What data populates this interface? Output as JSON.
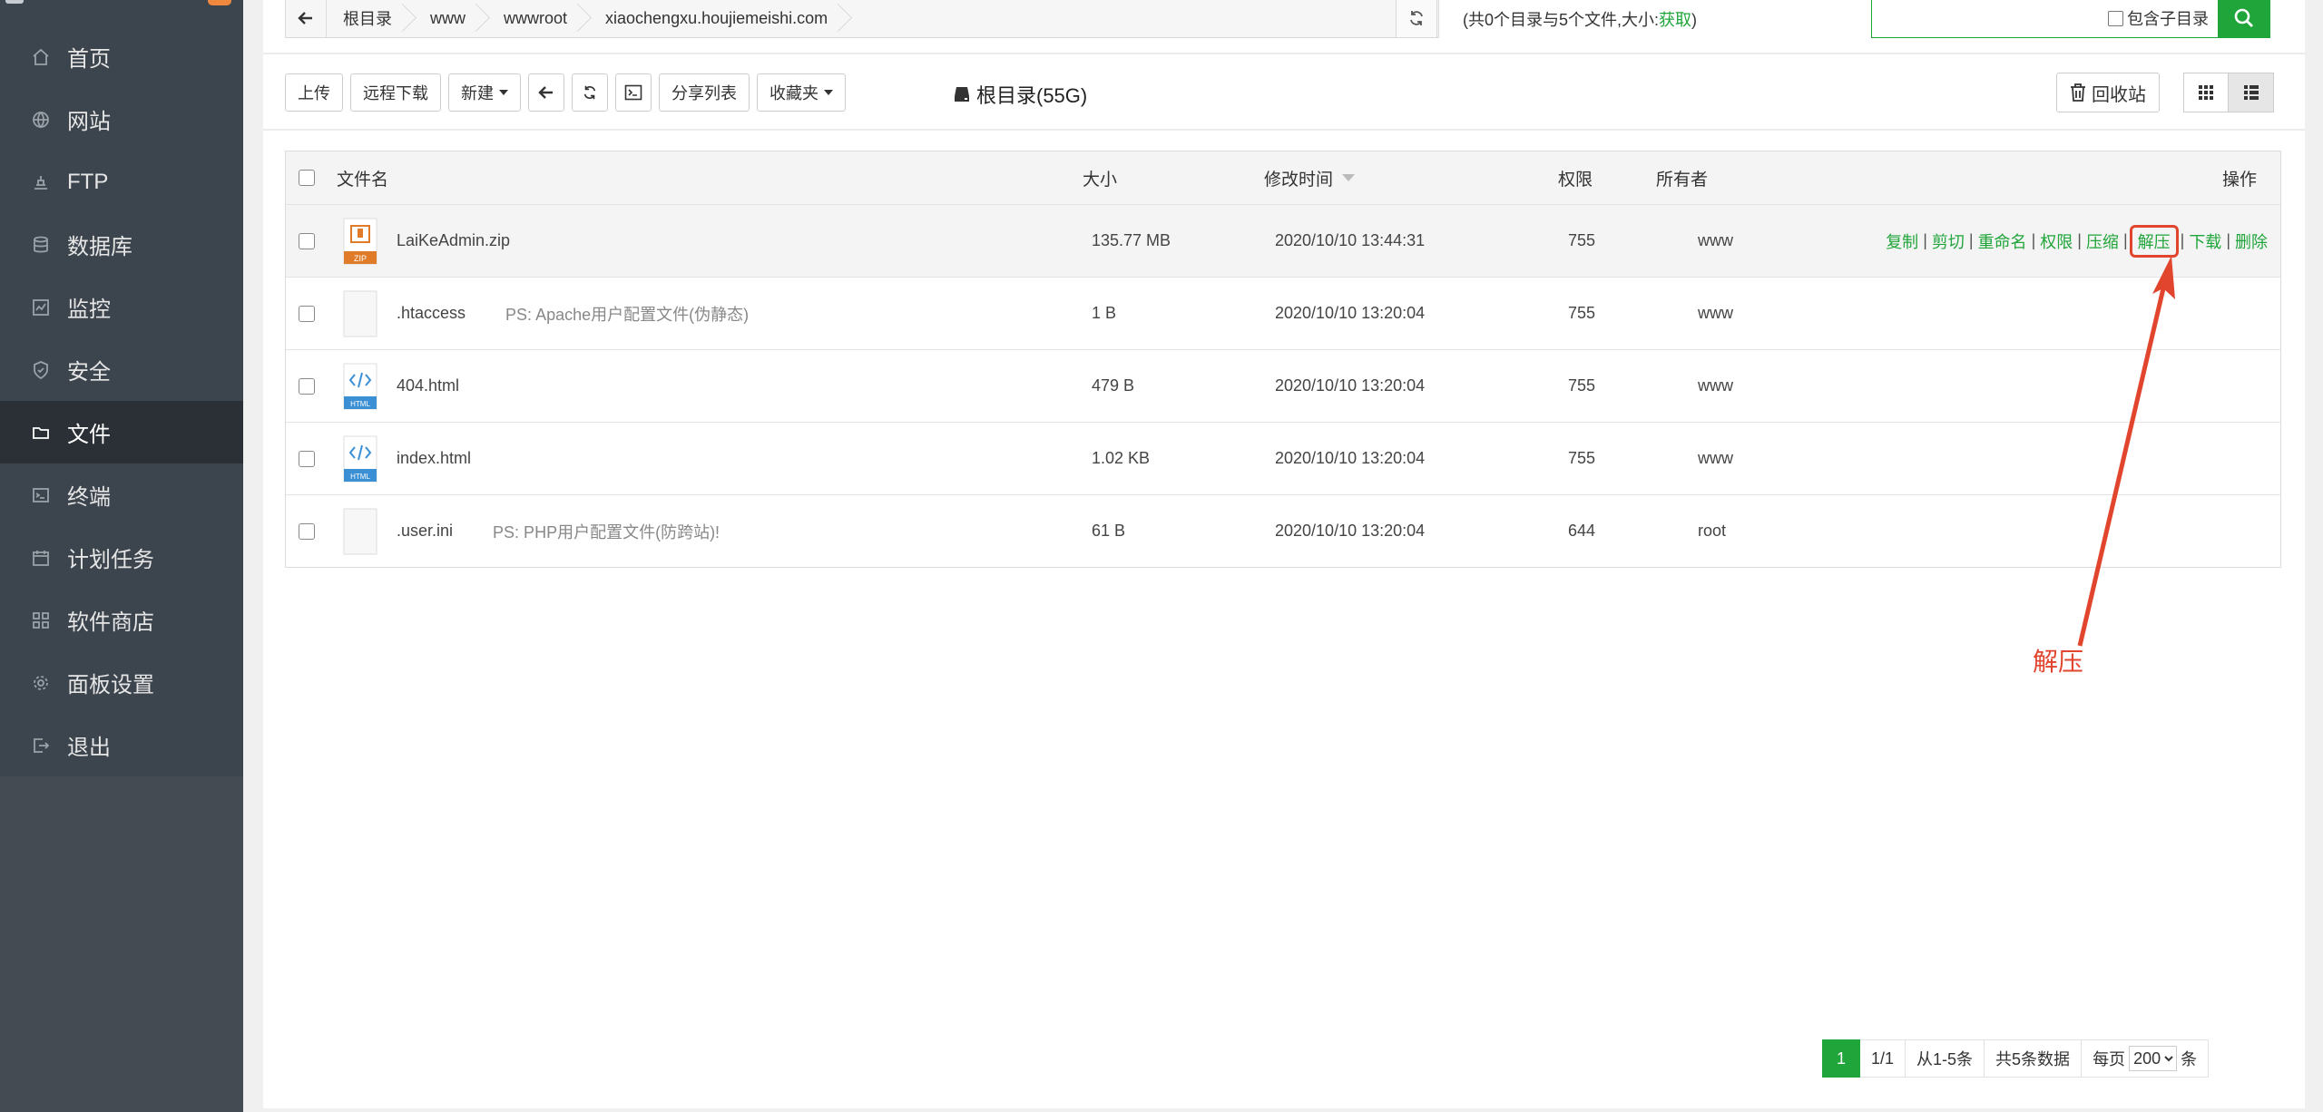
{
  "sidebar": {
    "items": [
      {
        "label": "首页",
        "icon": "home-icon"
      },
      {
        "label": "网站",
        "icon": "globe-icon"
      },
      {
        "label": "FTP",
        "icon": "ftp-icon"
      },
      {
        "label": "数据库",
        "icon": "database-icon"
      },
      {
        "label": "监控",
        "icon": "monitor-icon"
      },
      {
        "label": "安全",
        "icon": "shield-icon"
      },
      {
        "label": "文件",
        "icon": "folder-icon",
        "active": true
      },
      {
        "label": "终端",
        "icon": "terminal-icon"
      },
      {
        "label": "计划任务",
        "icon": "calendar-icon"
      },
      {
        "label": "软件商店",
        "icon": "grid-icon"
      },
      {
        "label": "面板设置",
        "icon": "gear-icon"
      },
      {
        "label": "退出",
        "icon": "logout-icon"
      }
    ]
  },
  "pathbar": {
    "crumbs": [
      "根目录",
      "www",
      "wwwroot",
      "xiaochengxu.houjiemeishi.com"
    ],
    "info_prefix": "(共0个目录与5个文件,大小:",
    "info_link": "获取",
    "info_suffix": ")"
  },
  "search": {
    "placeholder": "",
    "subdir_label": "包含子目录"
  },
  "toolbar": {
    "upload": "上传",
    "remote_download": "远程下载",
    "new": "新建",
    "share_list": "分享列表",
    "favorites": "收藏夹",
    "disk_label": "根目录(55G)",
    "recycle": "回收站"
  },
  "table": {
    "headers": {
      "name": "文件名",
      "size": "大小",
      "mtime": "修改时间",
      "perm": "权限",
      "owner": "所有者",
      "ops": "操作"
    },
    "rows": [
      {
        "name": "LaiKeAdmin.zip",
        "note": "",
        "size": "135.77 MB",
        "mtime": "2020/10/10 13:44:31",
        "perm": "755",
        "owner": "www",
        "type": "zip"
      },
      {
        "name": ".htaccess",
        "note": "PS: Apache用户配置文件(伪静态)",
        "size": "1 B",
        "mtime": "2020/10/10 13:20:04",
        "perm": "755",
        "owner": "www",
        "type": "file"
      },
      {
        "name": "404.html",
        "note": "",
        "size": "479 B",
        "mtime": "2020/10/10 13:20:04",
        "perm": "755",
        "owner": "www",
        "type": "html"
      },
      {
        "name": "index.html",
        "note": "",
        "size": "1.02 KB",
        "mtime": "2020/10/10 13:20:04",
        "perm": "755",
        "owner": "www",
        "type": "html"
      },
      {
        "name": ".user.ini",
        "note": "PS: PHP用户配置文件(防跨站)!",
        "size": "61 B",
        "mtime": "2020/10/10 13:20:04",
        "perm": "644",
        "owner": "root",
        "type": "file"
      }
    ],
    "ops": [
      "复制",
      "剪切",
      "重命名",
      "权限",
      "压缩",
      "解压",
      "下载",
      "删除"
    ],
    "zip_badge": "ZIP",
    "html_badge": "HTML"
  },
  "pager": {
    "current": "1",
    "pages": "1/1",
    "range": "从1-5条",
    "total": "共5条数据",
    "per_page_prefix": "每页",
    "per_page": "200",
    "per_page_suffix": "条"
  },
  "annotation": {
    "text": "解压",
    "color": "#e2452d"
  },
  "colors": {
    "accent": "#20a53a",
    "sidebar": "#3c444d"
  }
}
